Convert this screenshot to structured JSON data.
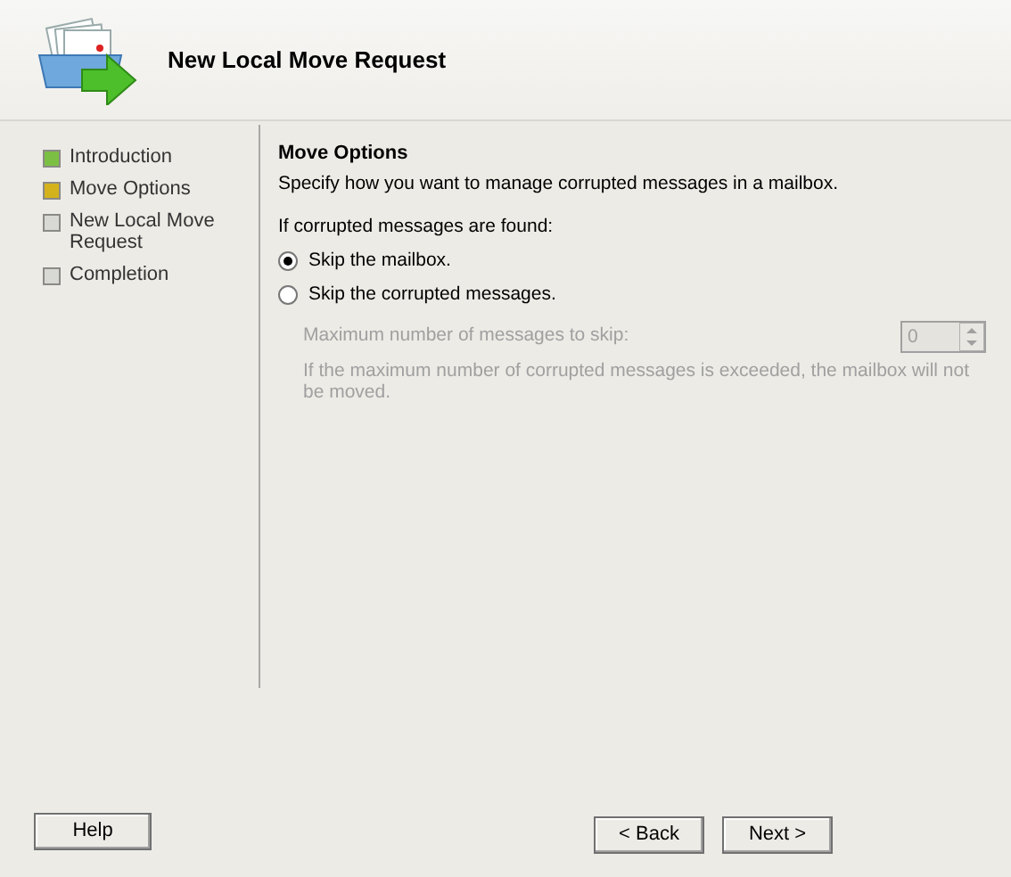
{
  "header": {
    "title": "New Local Move Request"
  },
  "steps": [
    {
      "label": "Introduction",
      "color": "#7cc043"
    },
    {
      "label": "Move Options",
      "color": "#d4b21c"
    },
    {
      "label": "New Local Move Request",
      "color": "#d8d8d4"
    },
    {
      "label": "Completion",
      "color": "#d8d8d4"
    }
  ],
  "content": {
    "heading": "Move Options",
    "description": "Specify how you want to manage corrupted messages in a mailbox.",
    "prompt": "If corrupted messages are found:",
    "options": [
      {
        "label": "Skip the mailbox.",
        "selected": true
      },
      {
        "label": "Skip the corrupted messages.",
        "selected": false
      }
    ],
    "max_field": {
      "label": "Maximum number of messages to skip:",
      "value": "0",
      "disabled": true
    },
    "note": "If the maximum number of corrupted messages is exceeded, the mailbox will not be moved."
  },
  "buttons": [
    {
      "label": "Help",
      "kind": "help"
    },
    {
      "label": "< Back",
      "kind": "nav"
    },
    {
      "label": "Next >",
      "kind": "nav"
    }
  ]
}
